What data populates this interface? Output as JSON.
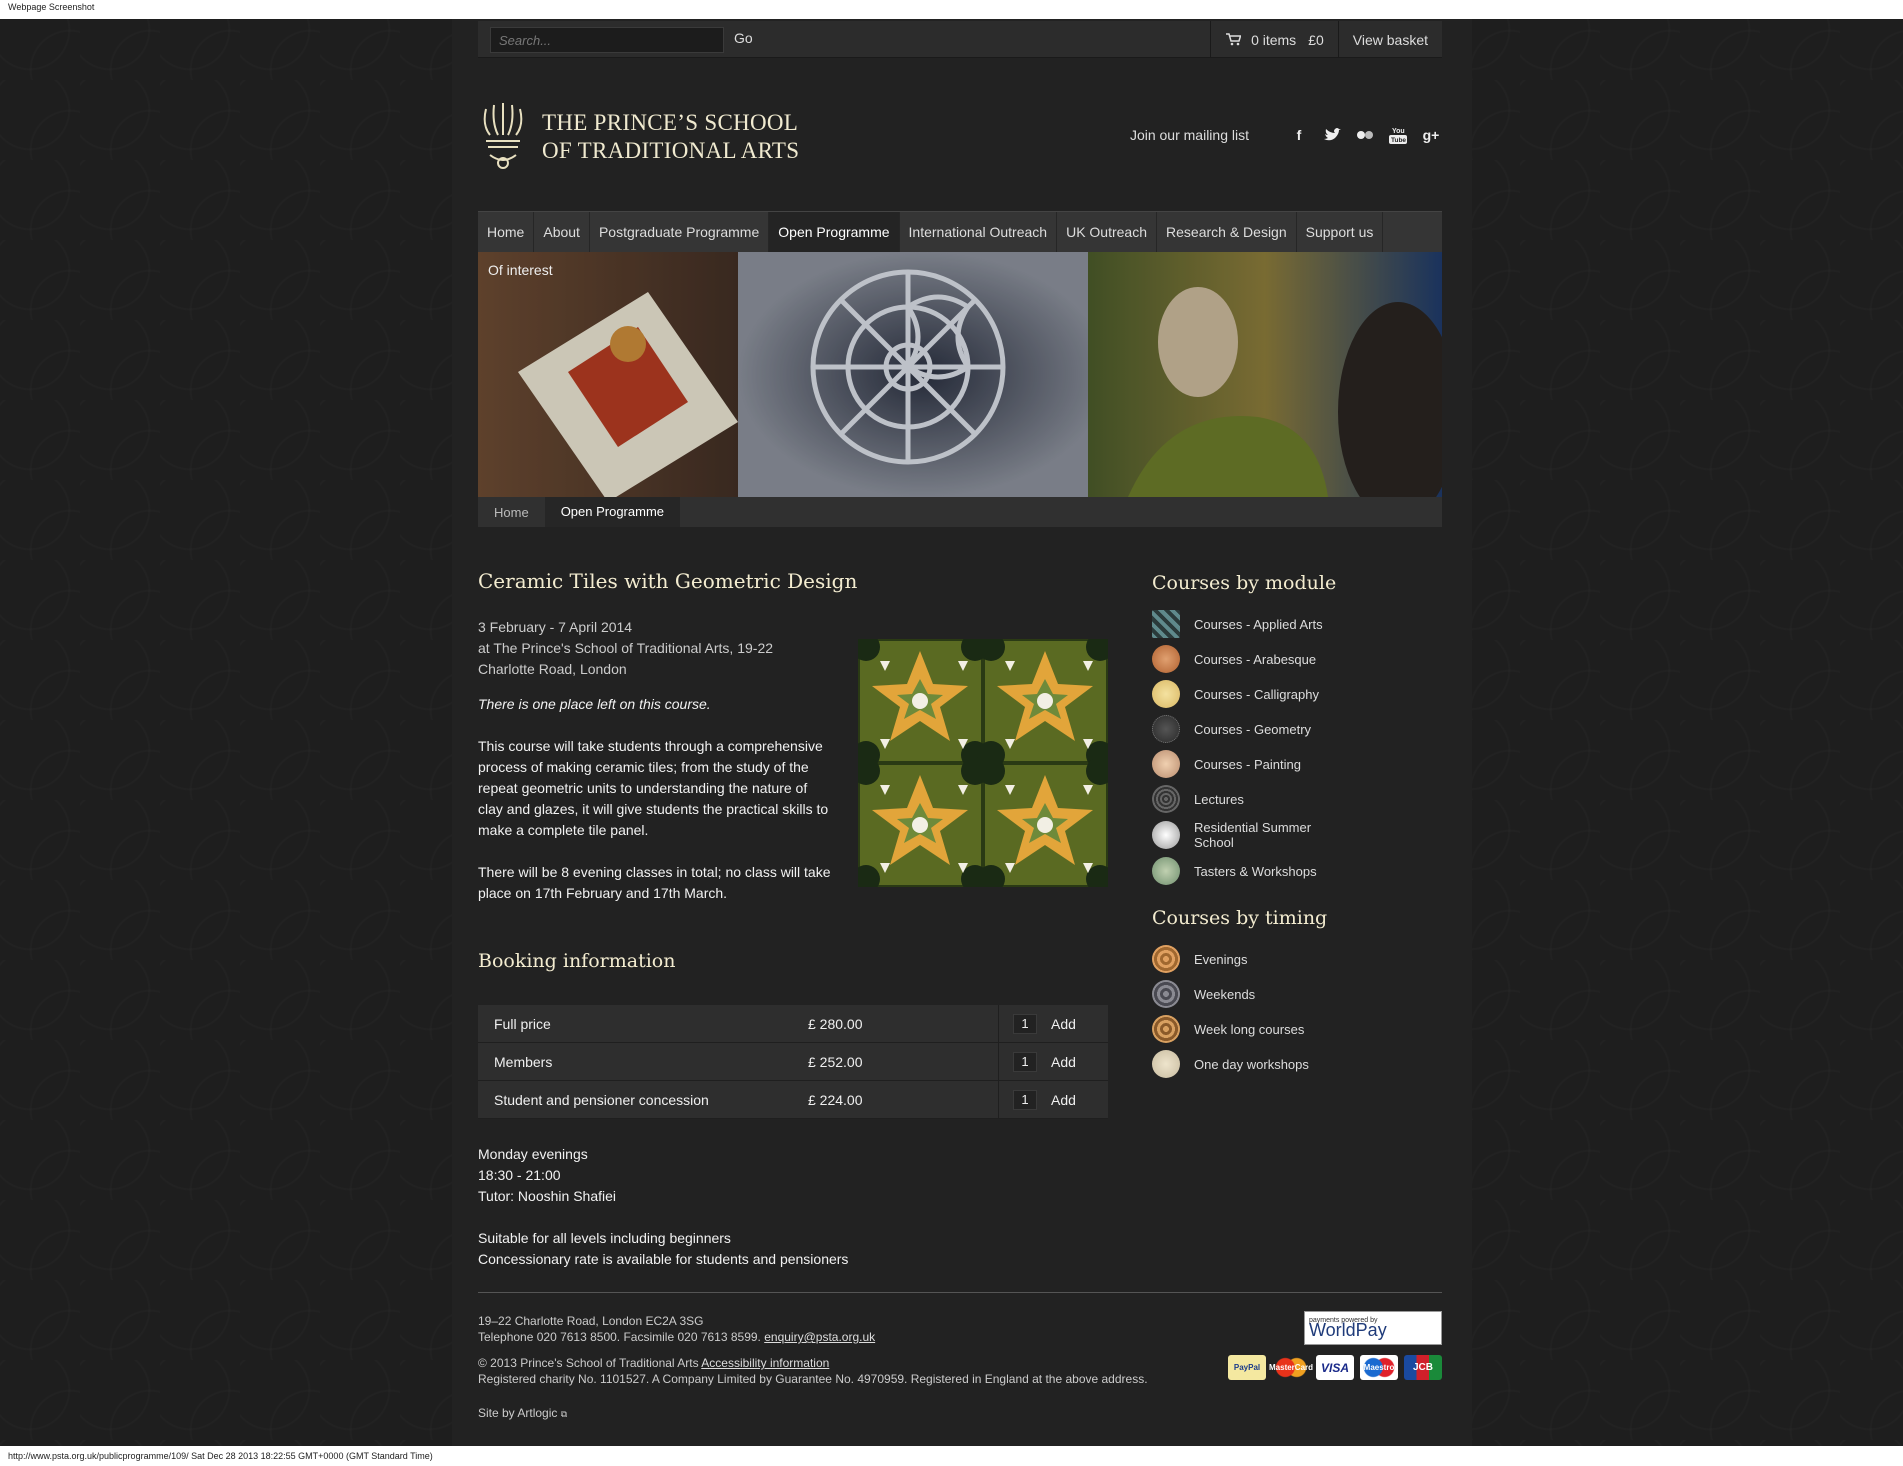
{
  "browser": {
    "title": "Webpage Screenshot",
    "status": "http://www.psta.org.uk/publicprogramme/109/ Sat Dec 28 2013 18:22:55 GMT+0000 (GMT Standard Time)"
  },
  "utility": {
    "search_placeholder": "Search...",
    "go_label": "Go",
    "items": "0 items",
    "total": "£0",
    "view_basket": "View basket"
  },
  "header": {
    "logo_line1": "THE PRINCE’S SCHOOL",
    "logo_line2": "OF TRADITIONAL ARTS",
    "mailing": "Join our mailing list",
    "social_icons": [
      "facebook-icon",
      "twitter-icon",
      "flickr-icon",
      "youtube-icon",
      "google-plus-icon"
    ]
  },
  "nav": {
    "items": [
      "Home",
      "About",
      "Postgraduate Programme",
      "Open Programme",
      "International Outreach",
      "UK Outreach",
      "Research & Design",
      "Support us"
    ],
    "active": "Open Programme"
  },
  "hero": {
    "label": "Of interest"
  },
  "breadcrumb": {
    "home": "Home",
    "current": "Open Programme"
  },
  "course": {
    "title": "Ceramic Tiles with Geometric Design",
    "dates": "3 February - 7 April 2014",
    "venue_line1": "at The Prince's School of Traditional Arts, 19-22",
    "venue_line2": "Charlotte Road, London",
    "availability": "There is one place left on this course.",
    "description": "This course will take students through a comprehensive process of making ceramic tiles; from the study of the repeat geometric units to understanding the nature of clay and glazes, it will give students the practical skills to make a complete tile panel.",
    "classes": "There will be 8 evening classes in total; no class will take place on 17th February and 17th March."
  },
  "booking": {
    "title": "Booking information",
    "rows": [
      {
        "name": "Full price",
        "price": "£ 280.00",
        "qty": "1",
        "action": "Add"
      },
      {
        "name": "Members",
        "price": "£ 252.00",
        "qty": "1",
        "action": "Add"
      },
      {
        "name": "Student and pensioner concession",
        "price": "£ 224.00",
        "qty": "1",
        "action": "Add"
      }
    ]
  },
  "details": {
    "day": "Monday evenings",
    "time": "18:30 - 21:00",
    "tutor": "Tutor: Nooshin Shafiei",
    "level": "Suitable for all levels including beginners",
    "concession": "Concessionary rate is available for students and pensioners"
  },
  "sidebar": {
    "module_title": "Courses by module",
    "modules": [
      {
        "label": "Courses - Applied Arts",
        "color": "#5f8a8c"
      },
      {
        "label": "Courses - Arabesque",
        "color": "#b0602f"
      },
      {
        "label": "Courses - Calligraphy",
        "color": "#d9b763"
      },
      {
        "label": "Courses - Geometry",
        "color": "#3a3a3a"
      },
      {
        "label": "Courses - Painting",
        "color": "#b98c6e"
      },
      {
        "label": "Lectures",
        "color": "#4a4a4a"
      },
      {
        "label": "Residential Summer School",
        "color": "#bbbbbb"
      },
      {
        "label": "Tasters & Workshops",
        "color": "#6f8f6e"
      }
    ],
    "timing_title": "Courses by timing",
    "timings": [
      {
        "label": "Evenings",
        "color": "#c98a4a"
      },
      {
        "label": "Weekends",
        "color": "#6a6a72"
      },
      {
        "label": "Week long courses",
        "color": "#b57b45"
      },
      {
        "label": "One day workshops",
        "color": "#d8ccb0"
      }
    ]
  },
  "footer": {
    "address": "19–22 Charlotte Road, London EC2A 3SG",
    "phone": "Telephone 020 7613 8500. Facsimile 020 7613 8599.",
    "email": "enquiry@psta.org.uk",
    "copyright": "© 2013 Prince's School of Traditional Arts",
    "accessibility": "Accessibility information",
    "charity": "Registered charity No. 1101527. A Company Limited by Guarantee No. 4970959. Registered in England at the above address.",
    "site_by": "Site by Artlogic",
    "worldpay_small": "payments powered by",
    "worldpay": "WorldPay",
    "cards": [
      "PayPal",
      "MasterCard",
      "VISA",
      "Maestro",
      "JCB"
    ]
  }
}
